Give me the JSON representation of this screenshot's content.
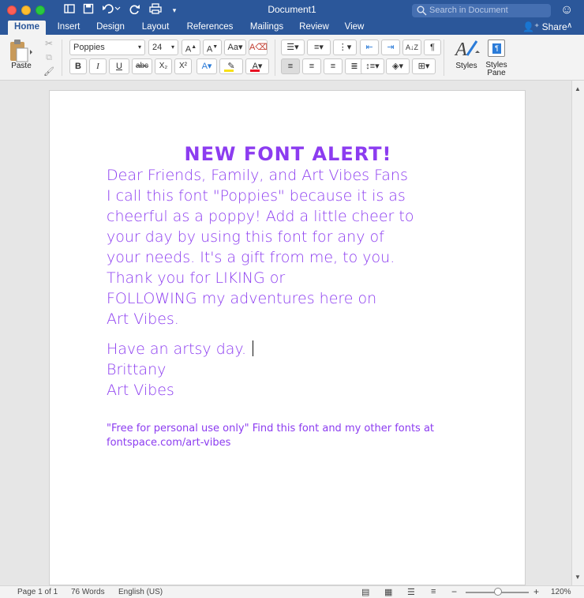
{
  "window": {
    "title": "Document1",
    "search_placeholder": "Search in Document"
  },
  "tabs": [
    {
      "label": "Home",
      "active": true
    },
    {
      "label": "Insert"
    },
    {
      "label": "Design"
    },
    {
      "label": "Layout"
    },
    {
      "label": "References"
    },
    {
      "label": "Mailings"
    },
    {
      "label": "Review"
    },
    {
      "label": "View"
    }
  ],
  "share_label": "Share",
  "ribbon": {
    "paste_label": "Paste",
    "font_name": "Poppies",
    "font_size": "24",
    "bold": "B",
    "italic": "I",
    "underline": "U",
    "strike": "abc",
    "subscript": "X₂",
    "superscript": "X²",
    "styles_label": "Styles",
    "styles_pane_label": "Styles\nPane",
    "font_color": "#e81123",
    "highlight_color": "#f7e017"
  },
  "document": {
    "heading": "NEW FONT ALERT!",
    "lines": [
      "Dear Friends, Family, and Art Vibes Fans",
      "     I call this font \"Poppies\" because it is as",
      "cheerful as a poppy!  Add a little cheer to",
      "your day by using this font for any of",
      "your needs.  It's a gift from me, to you.",
      "Thank you for LIKING or",
      "FOLLOWING my adventures here on",
      "Art Vibes.",
      "Have an artsy day.",
      "Brittany",
      "Art Vibes"
    ],
    "footnote_1": "\"Free for personal use only\"  Find this font and my other fonts at",
    "footnote_2": "fontspace.com/art-vibes",
    "text_color": "#8c3cf0"
  },
  "statusbar": {
    "page": "Page 1 of 1",
    "words": "76 Words",
    "language": "English (US)",
    "zoom": "120%",
    "zoom_minus": "−",
    "zoom_plus": "+"
  }
}
